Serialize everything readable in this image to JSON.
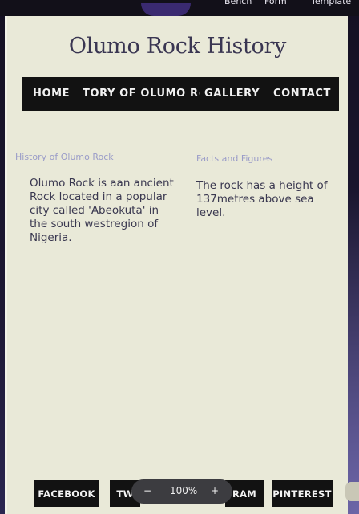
{
  "browser_top": {
    "links": [
      "Bench",
      "Form",
      "Template"
    ]
  },
  "site": {
    "title": "Olumo Rock History"
  },
  "nav": {
    "items": [
      "HOME",
      "TORY OF OLUMO R(",
      "GALLERY",
      "CONTACT"
    ]
  },
  "columns": {
    "left": {
      "heading": "History of Olumo Rock",
      "text": "Olumo Rock is aan ancient Rock located in a popular city called 'Abeokuta' in the south westregion of Nigeria."
    },
    "right": {
      "heading": "Facts and Figures",
      "text": "The rock has a height of 137metres above sea level."
    }
  },
  "footer": {
    "buttons": [
      "FACEBOOK",
      "TW",
      "RAM",
      "PINTEREST"
    ]
  },
  "zoom": {
    "minus": "−",
    "value": "100%",
    "plus": "+"
  },
  "colors": {
    "page_bg": "#e9e9d8",
    "nav_bg": "#121212",
    "title": "#3a3652",
    "heading": "#9a9cc8",
    "body_text": "#3a3850"
  }
}
